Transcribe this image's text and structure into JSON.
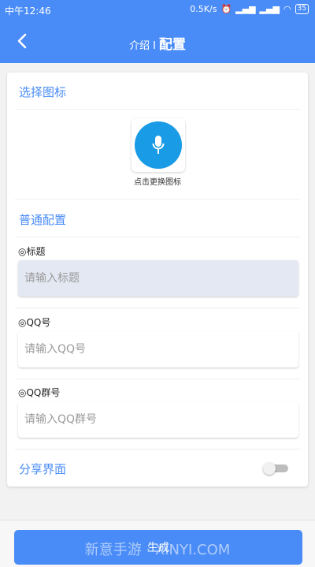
{
  "status_bar": {
    "time": "中午12:46",
    "speed": "0.5K/s",
    "battery": "35"
  },
  "header": {
    "tab_intro": "介绍",
    "separator": "I",
    "tab_config": "配置"
  },
  "icon_section": {
    "title": "选择图标",
    "icon": "microphone-icon",
    "caption": "点击更换图标"
  },
  "general_section": {
    "title": "普通配置",
    "fields": [
      {
        "label": "◎标题",
        "placeholder": "请输入标题",
        "value": ""
      },
      {
        "label": "◎QQ号",
        "placeholder": "请输入QQ号",
        "value": ""
      },
      {
        "label": "◎QQ群号",
        "placeholder": "请输入QQ群号",
        "value": ""
      }
    ]
  },
  "share": {
    "label": "分享界面",
    "enabled": false
  },
  "generate_button": {
    "label": "生成"
  },
  "watermark": "新意手游 · XINYI.COM",
  "colors": {
    "primary": "#4a8cf7",
    "icon_circle": "#1a9be6",
    "active_field": "#e4e8f3"
  }
}
